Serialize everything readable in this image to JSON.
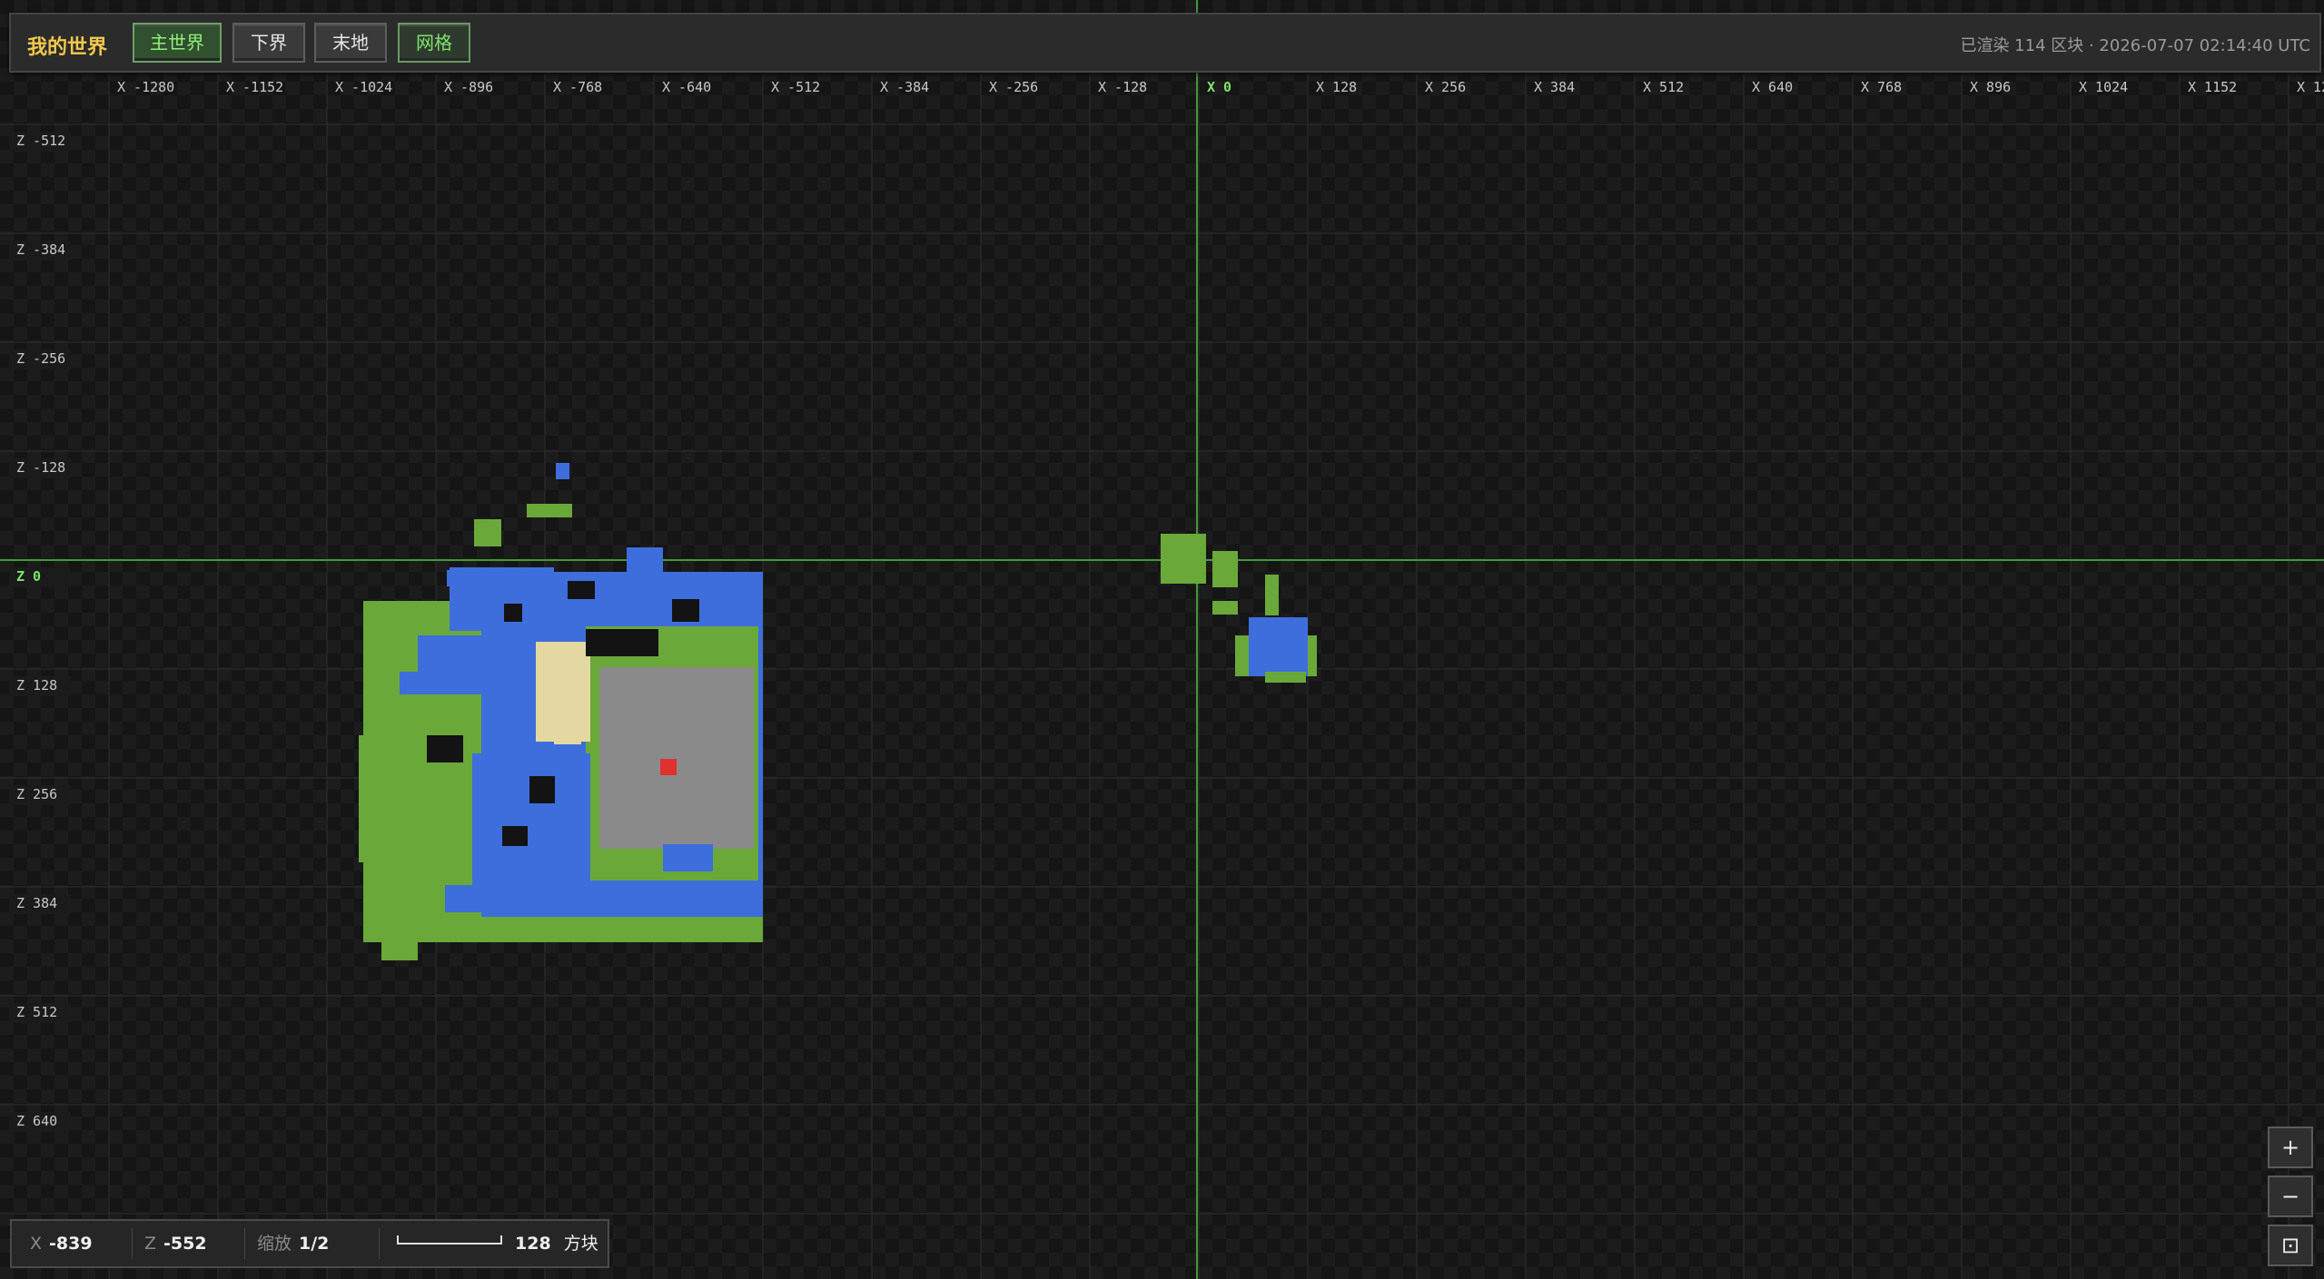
{
  "header": {
    "title": "我的世界",
    "dimension_tabs": [
      "主世界",
      "下界",
      "末地"
    ],
    "active_tab": "主世界",
    "grid_toggle": "网格",
    "status_text": "已渲染 114 区块 · 2026-07-07 02:14:40 UTC"
  },
  "grid": {
    "x_labels": [
      "X -1280",
      "X -1152",
      "X -1024",
      "X -896",
      "X -768",
      "X -640",
      "X -512",
      "X -384",
      "X -256",
      "X -128",
      "X 0",
      "X 128",
      "X 256",
      "X 384",
      "X 512",
      "X 640",
      "X 768",
      "X 896",
      "X 1024",
      "X 1152",
      "X 12"
    ],
    "z_labels": [
      "Z -512",
      "Z -384",
      "Z -256",
      "Z -128",
      "Z 0",
      "Z 128",
      "Z 256",
      "Z 384",
      "Z 512",
      "Z 640"
    ],
    "origin_label_color": "#7fe36b",
    "axis_line_color": "#3f9a3a"
  },
  "terrain_colors": {
    "water": "#3d6edc",
    "grass": "#6aa83a",
    "sand": "#e4d8a2",
    "stone": "#8a8a8a",
    "marker": "#e03131"
  },
  "coords": {
    "x_key": "X",
    "x_value": "-839",
    "z_key": "Z",
    "z_value": "-552",
    "zoom_key": "缩放",
    "zoom_value": "1/2",
    "scale_value": "128",
    "scale_unit": "方块"
  },
  "zoom_controls": {
    "zoom_in": "+",
    "zoom_out": "−",
    "reset": "⊡"
  }
}
